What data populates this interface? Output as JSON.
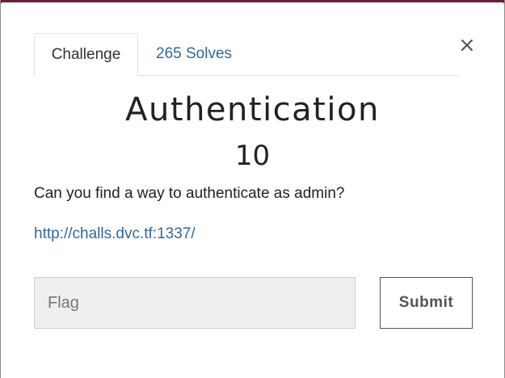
{
  "colors": {
    "accent": "#6b1f35",
    "link": "#31699e",
    "input_background": "#efefef"
  },
  "tabs": [
    {
      "label": "Challenge",
      "active": true
    },
    {
      "label": "265 Solves",
      "active": false
    }
  ],
  "close_icon": {
    "icon": "close-icon",
    "glyph": "×"
  },
  "challenge": {
    "name": "Authentication",
    "value": "10",
    "description": "Can you find a way to authenticate as admin?",
    "link": "http://challs.dvc.tf:1337/"
  },
  "form": {
    "flag_placeholder": "Flag",
    "flag_value": "",
    "submit_label": "Submit"
  }
}
